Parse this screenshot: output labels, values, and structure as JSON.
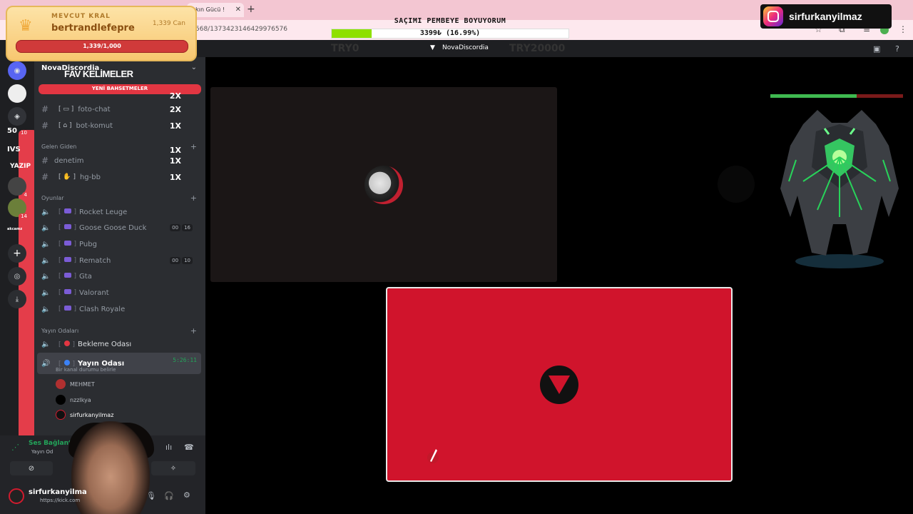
{
  "browser": {
    "tab_title": "şkın Gücü !",
    "url": "568/1373423146429976576"
  },
  "goal": {
    "title": "SAÇIMI PEMBEYE BOYUYORUM",
    "amount_text": "3399₺ (16.99%)",
    "progress_fraction": 0.1699
  },
  "instagram": {
    "handle": "sirfurkanyilmaz"
  },
  "king": {
    "label": "MEVCUT KRAL",
    "username": "bertrandlefepre",
    "health": "1,339 Can",
    "bar_text": "1,339/1,000"
  },
  "title_bar": {
    "server": "NovaDiscordia",
    "ghost_left": "TRY0",
    "ghost_right": "TRY20000"
  },
  "rail": {
    "text_items": [
      "50",
      "IVS",
      "YAZIP",
      "akcamz"
    ],
    "badges": [
      "0",
      "10",
      "4",
      "14"
    ]
  },
  "sidebar": {
    "server_name": "NovaDiscordia",
    "fav_title": "FAV KELİMELER",
    "bet_banner": "YENİ BAHSETMELER",
    "channels": [
      {
        "name": "foto-chat",
        "emoji": "📷",
        "mult": "2X"
      },
      {
        "name": "bot-komut",
        "emoji": "🤖",
        "mult": "1X"
      }
    ],
    "top_mult": "2X",
    "category_gelen": "Gelen Giden",
    "gelen_channels": [
      {
        "name": "denetim",
        "mult": "1X"
      },
      {
        "name": "hg-bb",
        "emoji": "👋",
        "mult": "1X"
      }
    ],
    "gelen_mult": "1X",
    "category_oyunlar": "Oyunlar",
    "games": [
      {
        "name": "Rocket Leuge",
        "counts": []
      },
      {
        "name": "Goose Goose Duck",
        "counts": [
          "00",
          "16"
        ]
      },
      {
        "name": "Pubg",
        "counts": []
      },
      {
        "name": "Rematch",
        "counts": [
          "00",
          "10"
        ]
      },
      {
        "name": "Gta",
        "counts": []
      },
      {
        "name": "Valorant",
        "counts": []
      },
      {
        "name": "Clash Royale",
        "counts": []
      }
    ],
    "category_yayin": "Yayın Odaları",
    "bekleme": "Bekleme Odası",
    "yayin_odasi": "Yayın Odası",
    "yayin_timer": "5:26:11",
    "status_prompt": "Bir kanal durumu belirle",
    "members": [
      "MEHMET",
      "nzzlkya",
      "sirfurkanyilmaz"
    ]
  },
  "user_panel": {
    "voice_connected": "Ses Bağlantısı",
    "voice_channel": "Yayın Od",
    "username": "sirfurkanyilma",
    "link": "https://kick.com"
  },
  "boss": {
    "hp_fraction": 0.65
  },
  "colors": {
    "accent_red": "#d0142c",
    "discord_green": "#23a55a",
    "goal_green": "#8ee000"
  }
}
